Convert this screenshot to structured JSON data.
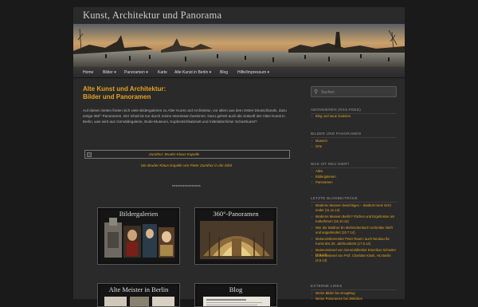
{
  "site": {
    "title": "Kunst, Architektur und Panorama"
  },
  "nav": {
    "items": [
      {
        "label": "Home",
        "arrow": ""
      },
      {
        "label": "Bilder",
        "arrow": "▾"
      },
      {
        "label": "Panoramen",
        "arrow": "▾"
      },
      {
        "label": "Karte",
        "arrow": ""
      },
      {
        "label": "Alte Kunst in Berlin",
        "arrow": "▾"
      },
      {
        "label": "Blog",
        "arrow": ""
      },
      {
        "label": "Hilfe/Impressum",
        "arrow": "▾"
      }
    ]
  },
  "post": {
    "title_line1": "Alte Kunst und Architektur:",
    "title_line2": "Bilder und Panoramen",
    "intro": "Auf diesen Seiten finden sich viele Bildergalerien zu Alter Kunst und Architektur, vor allem aus dem Osten Deutschlands, dazu einige 360°-Panoramen. Der Inhalt ist nur durch meine Interessen bestimmt. Dazu gehört auch die Zukunft der Alten Kunst in Berlin, was wird aus Gemäldegalerie, Bode-Museum, Kupferstichkabinett und mittelalterlicher Schatzkunst?",
    "image_alt": "Zumthor: Bruder-Klaus-Kapelle",
    "image_caption": "Die Bruder-Klaus-Kapelle von Peter Zumthor in der Eifel",
    "separator": "****************"
  },
  "tiles": [
    {
      "title": "Bildergalerien"
    },
    {
      "title": "360°-Panoramen"
    },
    {
      "title": "Alte Meister in Berlin"
    },
    {
      "title": "Blog"
    }
  ],
  "sidebar": {
    "search_placeholder": "Suchen",
    "sections": [
      {
        "title": "ABONNIEREN (RSS-FEED)",
        "items": [
          "Blog und neue Galerien"
        ]
      },
      {
        "title": "BILDER UND PANORAMEN",
        "items": [
          "Museen",
          "Orte"
        ]
      },
      {
        "title": "WAS IST NEU HIER?",
        "items": [
          "Alles",
          "Bildergalerien",
          "Panoramen"
        ]
      },
      {
        "title": "LETZTE BLOGBEITRÄGE",
        "items": [
          "Moderne Museen besichtigen – Stadtort trenk nicht ender (11.11.14)",
          "Moderne Museen Berlin? Fächen und Ergebnisse am Kulturforum (16.10.14)",
          "Wer der Boldner En Mehrschenbuch Schreiber stieft und angedendert (10.7.14)",
          "Museumskorrender Peter Raum: auch Neubau für Kunst des 20. Jahrhunderts (17.6.14)",
          "Museumsinsel von Generaldirektor Emerikus Schuster (7.5.14)",
          "Museumsinsel von Prof. Charlotte Klonk, HU Berlin (4.5.14)"
        ]
      },
      {
        "title": "EXTERNE LINKS",
        "items": [
          "Meine Bilder bei smugMug",
          "Meine Panoramen bei 360cities"
        ]
      }
    ]
  },
  "colors": {
    "accent": "#e6a321",
    "background": "#1a1a1a",
    "page": "#2a2a2a"
  }
}
